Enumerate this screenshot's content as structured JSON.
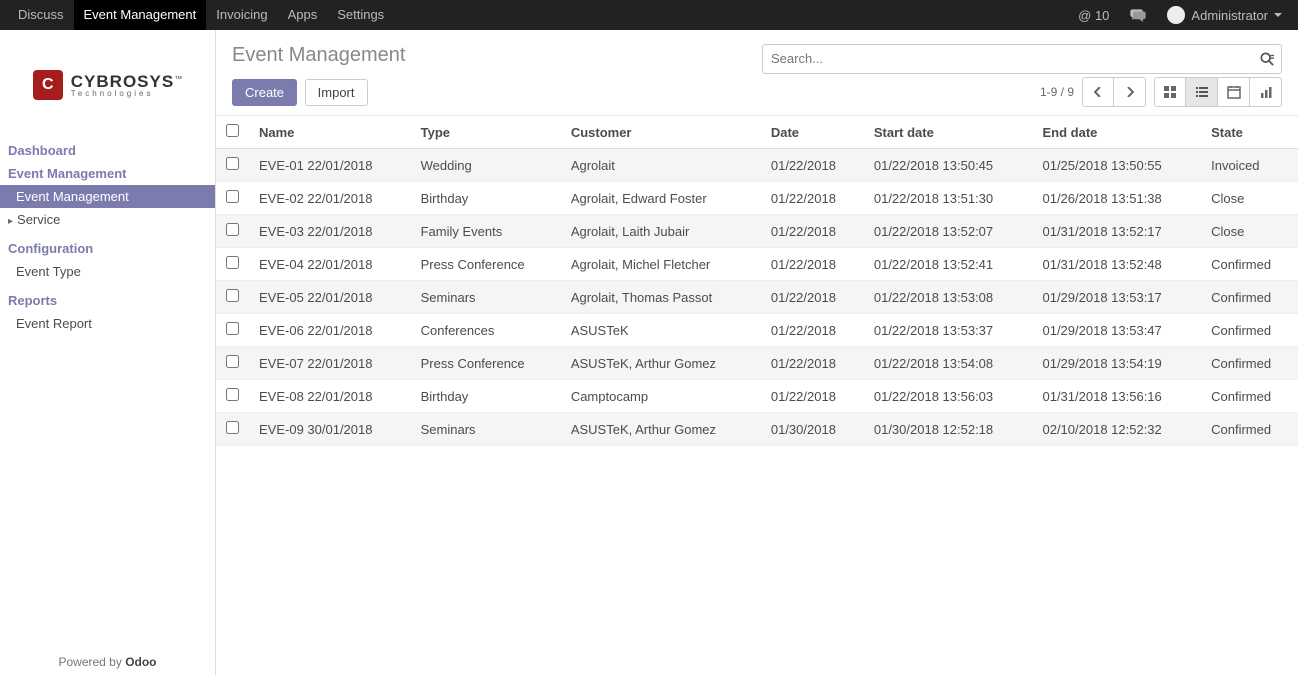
{
  "topnav": {
    "items": [
      "Discuss",
      "Event Management",
      "Invoicing",
      "Apps",
      "Settings"
    ],
    "active_index": 1
  },
  "topright": {
    "at_count": "@ 10",
    "user": "Administrator"
  },
  "logo": {
    "main": "CYBROSYS",
    "sub": "Technologies",
    "tm": "™"
  },
  "sidebar": {
    "dashboard": "Dashboard",
    "event_mgmt": "Event Management",
    "event_mgmt_sub": "Event Management",
    "service": "Service",
    "configuration": "Configuration",
    "event_type": "Event Type",
    "reports": "Reports",
    "event_report": "Event Report"
  },
  "footer": {
    "powered_by": "Powered by ",
    "odoo": "Odoo"
  },
  "header": {
    "title": "Event Management",
    "search_placeholder": "Search...",
    "create": "Create",
    "import_": "Import",
    "pager": "1-9 / 9"
  },
  "columns": [
    "Name",
    "Type",
    "Customer",
    "Date",
    "Start date",
    "End date",
    "State"
  ],
  "rows": [
    {
      "name": "EVE-01 22/01/2018",
      "type": "Wedding",
      "customer": "Agrolait",
      "date": "01/22/2018",
      "start": "01/22/2018 13:50:45",
      "end": "01/25/2018 13:50:55",
      "state": "Invoiced"
    },
    {
      "name": "EVE-02 22/01/2018",
      "type": "Birthday",
      "customer": "Agrolait, Edward Foster",
      "date": "01/22/2018",
      "start": "01/22/2018 13:51:30",
      "end": "01/26/2018 13:51:38",
      "state": "Close"
    },
    {
      "name": "EVE-03 22/01/2018",
      "type": "Family Events",
      "customer": "Agrolait, Laith Jubair",
      "date": "01/22/2018",
      "start": "01/22/2018 13:52:07",
      "end": "01/31/2018 13:52:17",
      "state": "Close"
    },
    {
      "name": "EVE-04 22/01/2018",
      "type": "Press Conference",
      "customer": "Agrolait, Michel Fletcher",
      "date": "01/22/2018",
      "start": "01/22/2018 13:52:41",
      "end": "01/31/2018 13:52:48",
      "state": "Confirmed"
    },
    {
      "name": "EVE-05 22/01/2018",
      "type": "Seminars",
      "customer": "Agrolait, Thomas Passot",
      "date": "01/22/2018",
      "start": "01/22/2018 13:53:08",
      "end": "01/29/2018 13:53:17",
      "state": "Confirmed"
    },
    {
      "name": "EVE-06 22/01/2018",
      "type": "Conferences",
      "customer": "ASUSTeK",
      "date": "01/22/2018",
      "start": "01/22/2018 13:53:37",
      "end": "01/29/2018 13:53:47",
      "state": "Confirmed"
    },
    {
      "name": "EVE-07 22/01/2018",
      "type": "Press Conference",
      "customer": "ASUSTeK, Arthur Gomez",
      "date": "01/22/2018",
      "start": "01/22/2018 13:54:08",
      "end": "01/29/2018 13:54:19",
      "state": "Confirmed"
    },
    {
      "name": "EVE-08 22/01/2018",
      "type": "Birthday",
      "customer": "Camptocamp",
      "date": "01/22/2018",
      "start": "01/22/2018 13:56:03",
      "end": "01/31/2018 13:56:16",
      "state": "Confirmed"
    },
    {
      "name": "EVE-09 30/01/2018",
      "type": "Seminars",
      "customer": "ASUSTeK, Arthur Gomez",
      "date": "01/30/2018",
      "start": "01/30/2018 12:52:18",
      "end": "02/10/2018 12:52:32",
      "state": "Confirmed"
    }
  ]
}
